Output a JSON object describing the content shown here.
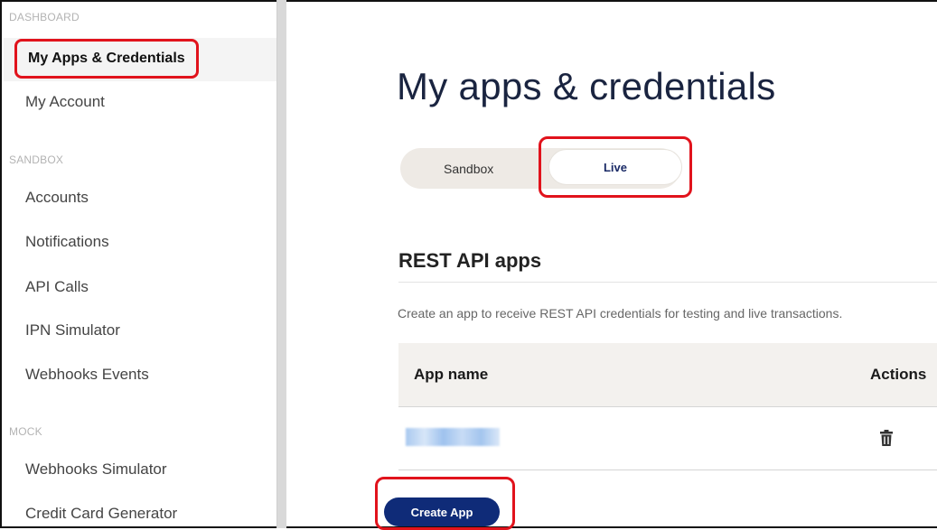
{
  "sidebar": {
    "sections": [
      {
        "label": "DASHBOARD"
      },
      {
        "label": "SANDBOX"
      },
      {
        "label": "MOCK"
      }
    ],
    "items": [
      {
        "label": "My Apps & Credentials"
      },
      {
        "label": "My Account"
      },
      {
        "label": "Accounts"
      },
      {
        "label": "Notifications"
      },
      {
        "label": "API Calls"
      },
      {
        "label": "IPN Simulator"
      },
      {
        "label": "Webhooks Events"
      },
      {
        "label": "Webhooks Simulator"
      },
      {
        "label": "Credit Card Generator"
      }
    ]
  },
  "main": {
    "title": "My apps & credentials",
    "env_toggle": {
      "sandbox": "Sandbox",
      "live": "Live",
      "selected": "Live"
    },
    "section_title": "REST API apps",
    "description": "Create an app to receive REST API credentials for testing and live transactions.",
    "table": {
      "columns": [
        "App name",
        "Actions"
      ],
      "rows": [
        {
          "action_icon": "trash-icon"
        }
      ]
    },
    "create_button": "Create App"
  },
  "colors": {
    "highlight": "#e1131c",
    "primary_button": "#0f2b78",
    "title": "#1a2440"
  }
}
